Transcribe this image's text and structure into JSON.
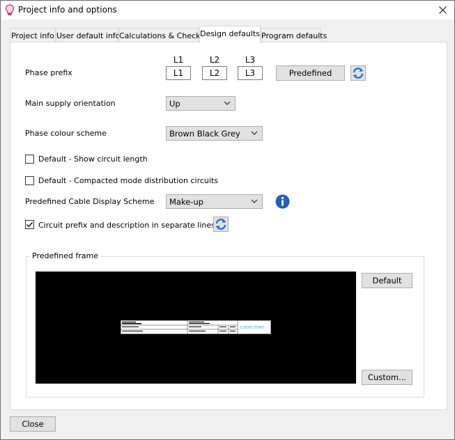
{
  "window": {
    "title": "Project info and options",
    "icon": "lightbulb-icon"
  },
  "tabs": [
    {
      "label": "Project info"
    },
    {
      "label": "User default info"
    },
    {
      "label": "Calculations & Checks"
    },
    {
      "label": "Design defaults"
    },
    {
      "label": "Program defaults"
    }
  ],
  "active_tab": "Design defaults",
  "design": {
    "phase_prefix": {
      "label": "Phase prefix",
      "headers": [
        "L1",
        "L2",
        "L3"
      ],
      "values": [
        "L1",
        "L2",
        "L3"
      ],
      "predefined_label": "Predefined",
      "refresh_icon": "refresh-icon"
    },
    "main_supply": {
      "label": "Main supply orientation",
      "value": "Up"
    },
    "phase_colour": {
      "label": "Phase colour scheme",
      "value": "Brown Black Grey"
    },
    "show_circuit_length": {
      "label": "Default - Show circuit length",
      "checked": false
    },
    "compacted_mode": {
      "label": "Default - Compacted mode distribution circuits",
      "checked": false
    },
    "cable_scheme": {
      "label": "Predefined Cable Display Scheme",
      "value": "Make-up",
      "info_icon": "info-icon"
    },
    "circuit_prefix": {
      "label": "Circuit prefix and description in separate lines",
      "checked": true,
      "refresh_icon": "refresh-icon"
    },
    "frame": {
      "title": "Predefined frame",
      "default_label": "Default",
      "custom_label": "Custom...",
      "preview_logo_text": "CODECFORT"
    }
  },
  "footer": {
    "close_label": "Close"
  },
  "colors": {
    "tab_border": "#d9d9d9",
    "button_face": "#e1e1e1",
    "info_blue": "#1f5fbf",
    "refresh_blue": "#1e6fd0"
  }
}
